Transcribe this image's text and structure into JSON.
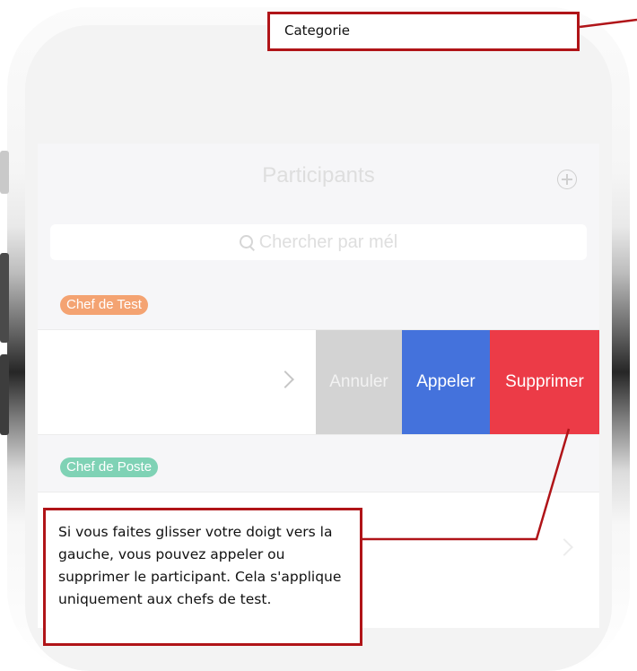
{
  "annotation": {
    "category_label": "Categorie",
    "note_text": "Si vous faites glisser votre doigt vers la gauche, vous pouvez appeler ou supprimer le participant. Cela s'applique uniquement aux chefs de test.",
    "border_color": "#b01418"
  },
  "app": {
    "title": "Participants",
    "add_icon": "add-circle-icon",
    "search": {
      "placeholder": "Chercher par mél",
      "icon": "search-icon"
    },
    "sections": [
      {
        "tag": "Chef de Test",
        "color": "#f4a372"
      },
      {
        "tag": "Chef de Poste",
        "color": "#7fd2b5"
      }
    ],
    "swipe_actions": {
      "cancel": "Annuler",
      "call": "Appeler",
      "delete": "Supprimer",
      "colors": {
        "cancel": "#d3d3d3",
        "call": "#4472dc",
        "delete": "#ec3b47"
      }
    }
  }
}
